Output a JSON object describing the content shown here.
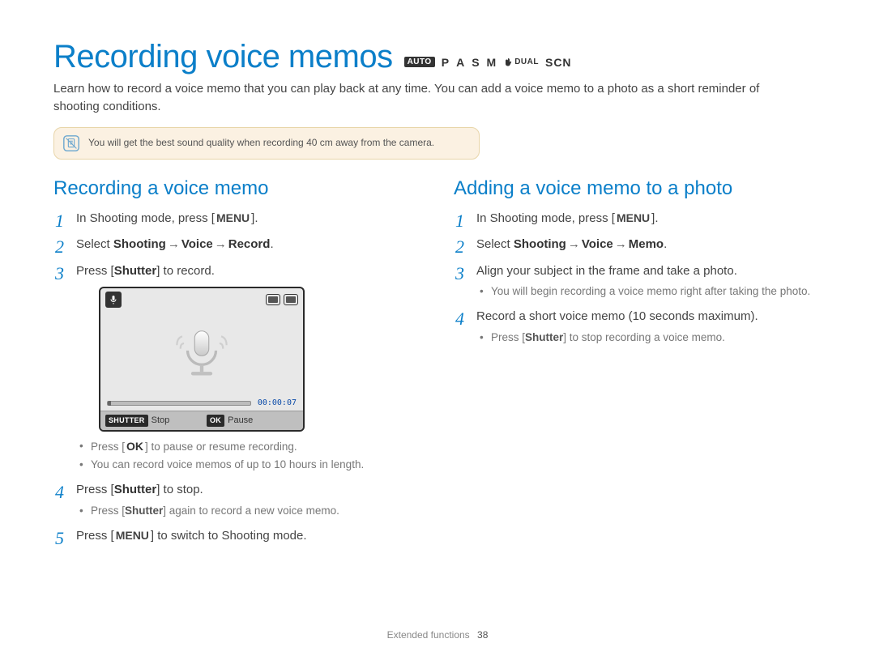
{
  "title": "Recording voice memos",
  "mode_strip": {
    "auto_badge": "AUTO",
    "p": "P",
    "a": "A",
    "s": "S",
    "m": "M",
    "dual_label": "DUAL",
    "scn": "SCN"
  },
  "intro": "Learn how to record a voice memo that you can play back at any time. You can add a voice memo to a photo as a short reminder of shooting conditions.",
  "note_text": "You will get the best sound quality when recording 40 cm away from the camera.",
  "left": {
    "heading": "Recording a voice memo",
    "steps": {
      "s1_pre": "In Shooting mode, press [",
      "s1_key": "MENU",
      "s1_post": "].",
      "s2_pre": "Select ",
      "s2_path_a": "Shooting",
      "s2_path_b": "Voice",
      "s2_path_c": "Record",
      "s2_post": ".",
      "s3_pre": "Press [",
      "s3_key": "Shutter",
      "s3_post": "] to record.",
      "s4_pre": "Press [",
      "s4_key": "Shutter",
      "s4_post": "] to stop.",
      "s5_pre": "Press [",
      "s5_key": "MENU",
      "s5_post": "] to switch to Shooting mode."
    },
    "lcd": {
      "time_elapsed": "00:00:07",
      "footer_left_tag": "SHUTTER",
      "footer_left_label": "Stop",
      "footer_right_tag": "OK",
      "footer_right_label": "Pause"
    },
    "sub_after_lcd": {
      "a_pre": "Press [",
      "a_key": "OK",
      "a_post": "] to pause or resume recording.",
      "b": "You can record voice memos of up to 10 hours in length."
    },
    "sub_after_step4": {
      "a_pre": "Press [",
      "a_key": "Shutter",
      "a_post": "] again to record a new voice memo."
    }
  },
  "right": {
    "heading": "Adding a voice memo to a photo",
    "steps": {
      "s1_pre": "In Shooting mode, press [",
      "s1_key": "MENU",
      "s1_post": "].",
      "s2_pre": "Select ",
      "s2_path_a": "Shooting",
      "s2_path_b": "Voice",
      "s2_path_c": "Memo",
      "s2_post": ".",
      "s3": "Align your subject in the frame and take a photo.",
      "s4": "Record a short voice memo (10 seconds maximum)."
    },
    "sub_after_step3": {
      "a": "You will begin recording a voice memo right after taking the photo."
    },
    "sub_after_step4": {
      "a_pre": "Press [",
      "a_key": "Shutter",
      "a_post": "] to stop recording a voice memo."
    }
  },
  "footer": {
    "section": "Extended functions",
    "page": "38"
  }
}
